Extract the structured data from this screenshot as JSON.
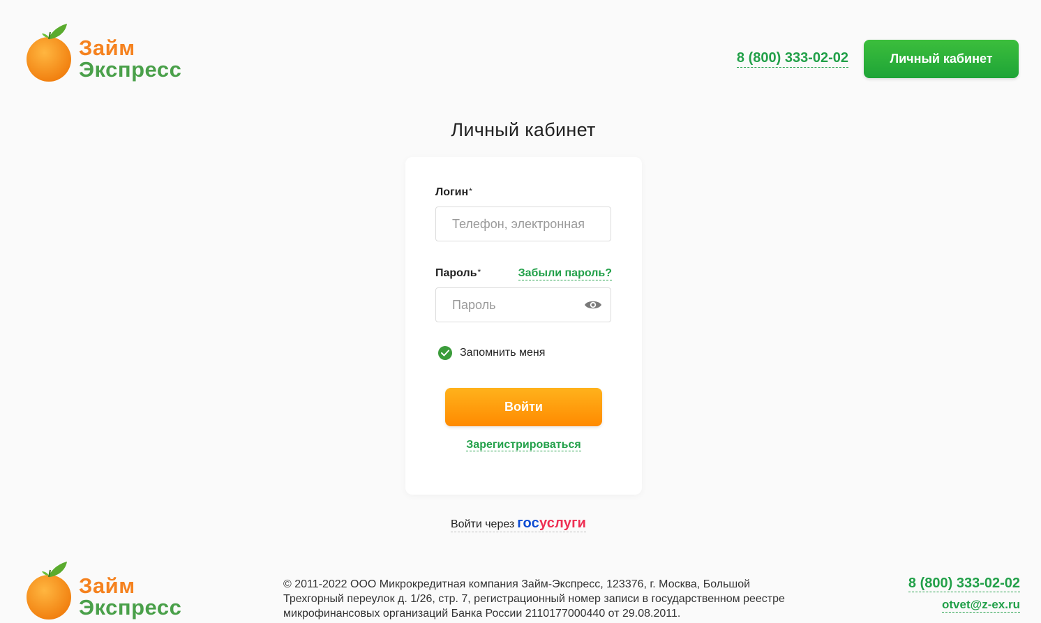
{
  "brand": {
    "line1": "Займ",
    "line2": "Экспресс",
    "colors": {
      "orange": "#f5821f",
      "green": "#4aa04a"
    }
  },
  "header": {
    "phone": "8 (800) 333-02-02",
    "cabinet_button": "Личный кабинет"
  },
  "page": {
    "title": "Личный кабинет"
  },
  "form": {
    "login_label": "Логин",
    "login_placeholder": "Телефон, электронная",
    "password_label": "Пароль",
    "password_placeholder": "Пароль",
    "required_mark": "*",
    "forgot_link": "Забыли пароль?",
    "remember_label": "Запомнить меня",
    "remember_checked": true,
    "submit_label": "Войти",
    "register_link": "Зарегистрироваться"
  },
  "gosuslugi": {
    "prefix": "Войти через",
    "brand_part1": "гос",
    "brand_part2": "услуги"
  },
  "footer": {
    "legal": "© 2011-2022 ООО Микрокредитная компания Займ-Экспресс, 123376, г. Москва, Большой Трехгорный переулок д. 1/26, стр. 7, регистрационный номер записи в государственном реестре микрофинансовых организаций Банка России 2110177000440 от 29.08.2011.",
    "phone": "8 (800) 333-02-02",
    "email": "otvet@z-ex.ru"
  },
  "colors": {
    "accent_green": "#22a049",
    "button_orange": "#ff9a0a",
    "page_background": "#fafafa"
  }
}
